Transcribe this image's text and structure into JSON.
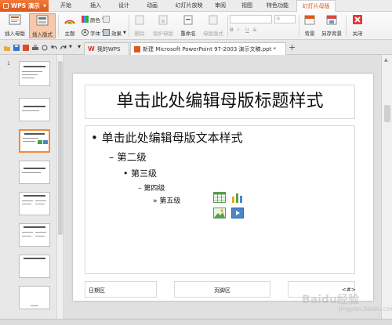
{
  "app": {
    "name": "WPS 演示"
  },
  "menu": {
    "tabs": [
      "开始",
      "插入",
      "设计",
      "动画",
      "幻灯片放映",
      "审阅",
      "视图",
      "特色功能",
      "幻灯片母版"
    ],
    "active_tab": "幻灯片母版"
  },
  "ribbon": {
    "insert_master": "插入母版",
    "insert_layout": "插入版式",
    "theme": "主题",
    "colors": "颜色",
    "fonts": "字体",
    "effects": "效果",
    "delete": "删除",
    "protect_master": "保护母版",
    "rename": "重命名",
    "master_layout": "母版版式",
    "font_size_value": "0",
    "background": "背景",
    "save_background": "另存背景",
    "close": "关闭",
    "format_buttons": [
      "B",
      "I",
      "U",
      "S"
    ]
  },
  "tabs": {
    "home": "我的WPS",
    "doc": "新建 Microsoft PowerPoint 97-2003 演示文稿.ppt *"
  },
  "thumbnails": {
    "first_number": "1"
  },
  "slide": {
    "title": "单击此处编辑母版标题样式",
    "levels": [
      "单击此处编辑母版文本样式",
      "第二级",
      "第三级",
      "第四级",
      "第五级"
    ],
    "bullets": [
      "•",
      "–",
      "•",
      "–",
      "»"
    ],
    "footer_date": "日期区",
    "footer_text": "页脚区",
    "footer_number": "<#>"
  },
  "colors": {
    "accent": "#e2551b",
    "selected_thumb": "#f08a3c"
  },
  "watermark": {
    "brand": "Baidu经验",
    "url": "jingyan.baidu.com"
  }
}
